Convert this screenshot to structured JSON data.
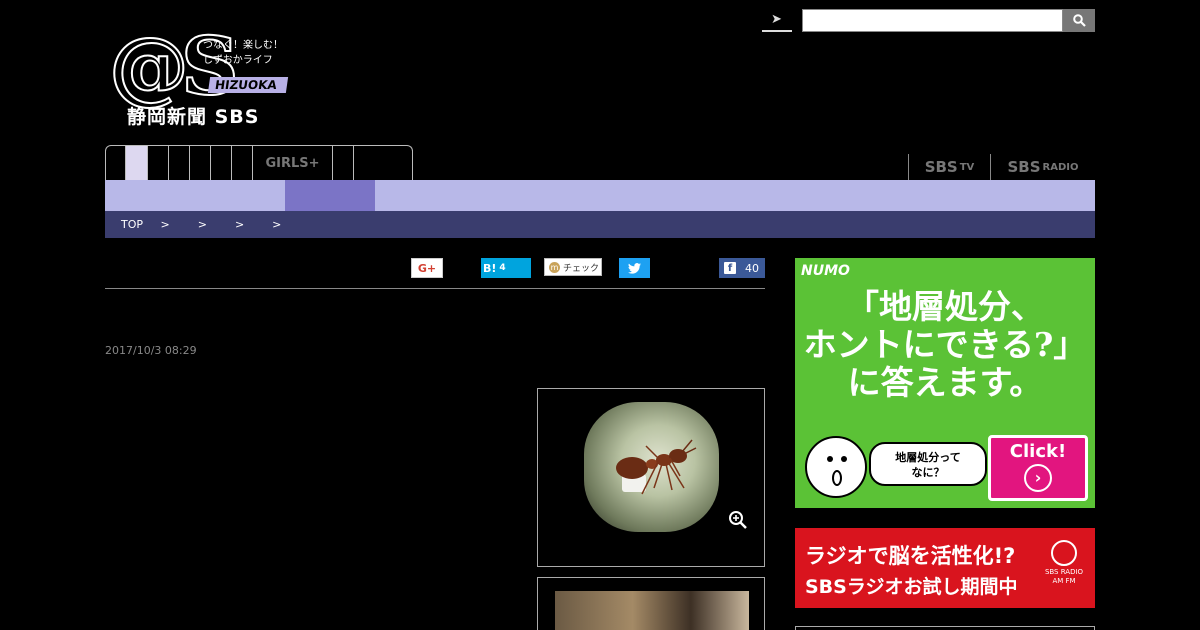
{
  "logo": {
    "katakana": "アットエス",
    "tagline_line1": "つなぐ！楽しむ！",
    "tagline_line2": "しずおかライフ",
    "shizuoka": "HIZUOKA",
    "newspaper": "静岡新聞 SBS"
  },
  "header": {
    "search_placeholder": ""
  },
  "nav": {
    "tabs": [
      "",
      "",
      "",
      "",
      "",
      "",
      "",
      "GIRLS+",
      "",
      ""
    ],
    "right_links": [
      {
        "main": "SBS",
        "sub": "TV"
      },
      {
        "main": "SBS",
        "sub": "RADIO"
      }
    ]
  },
  "breadcrumb": {
    "top": "TOP",
    "sep": ">"
  },
  "share": {
    "gplus": "G+",
    "hatena_label": "B!",
    "hatena_count": "4",
    "mixi_label": "チェック",
    "facebook_count": "40"
  },
  "article": {
    "date": "2017/10/3 08:29"
  },
  "ads": {
    "numo": {
      "brand": "NUMO",
      "headline_line1": "「地層処分、",
      "headline_line2": "ホントにできる?」",
      "headline_line3": "に答えます。",
      "bubble_line1": "地層処分って",
      "bubble_line2": "なに？",
      "click": "Click!"
    },
    "radio": {
      "line1": "ラジオで脳を活性化!?",
      "line2": "SBSラジオお試し期間中",
      "logo_line1": "SBS RADIO",
      "logo_line2": "AM FM"
    }
  },
  "colors": {
    "subnav": "#b8b8e8",
    "subnav_active": "#7b74c6",
    "breadcrumb_bg": "#3a3d6e",
    "numo_green": "#5bc236",
    "radio_red": "#d9141e"
  }
}
